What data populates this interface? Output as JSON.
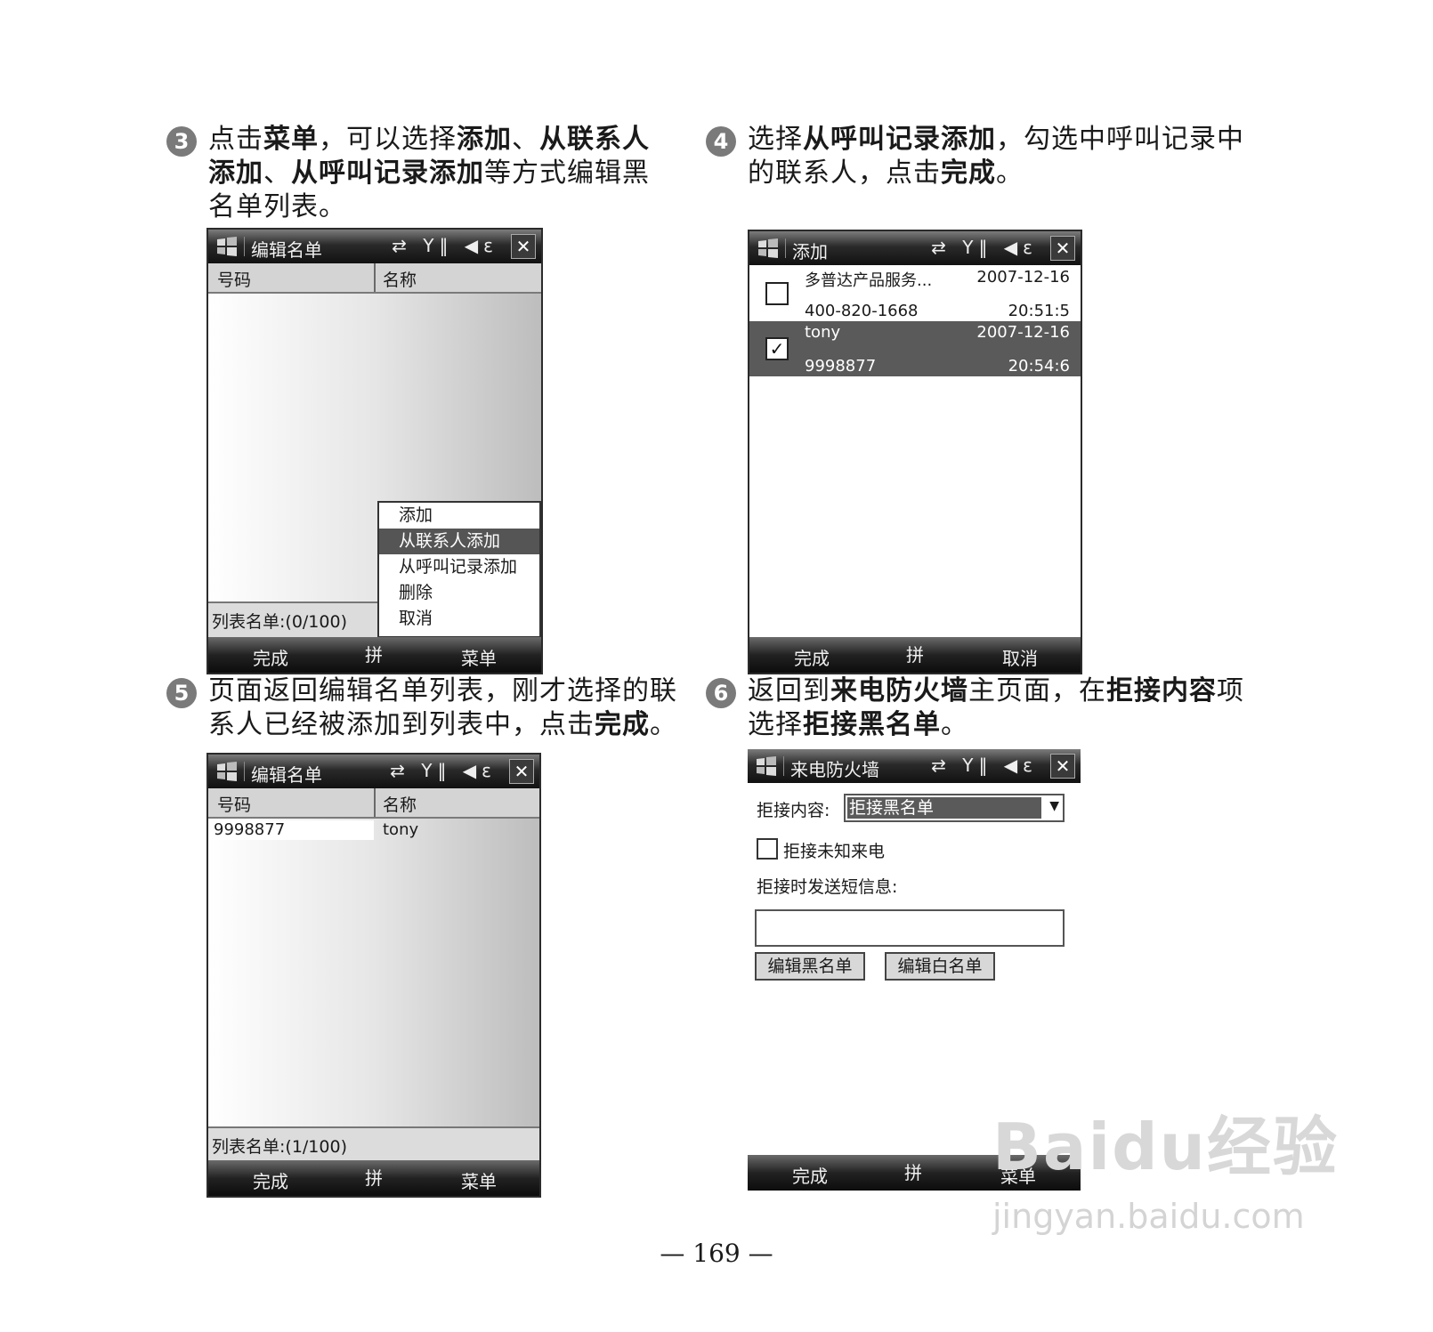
{
  "steps": [
    {
      "num": "3",
      "parts": [
        "点击",
        "菜单",
        "，可以选择",
        "添加",
        "、",
        "从联系人添加",
        "、",
        "从呼叫记录添加",
        "等方式编辑黑名单列表。"
      ]
    },
    {
      "num": "4",
      "parts": [
        "选择",
        "从呼叫记录添加",
        "，勾选中呼叫记录中的联系人，点击",
        "完成",
        "。"
      ]
    },
    {
      "num": "5",
      "parts": [
        "页面返回编辑名单列表，刚才选择的联系人已经被添加到列表中，点击",
        "完成",
        "。"
      ]
    },
    {
      "num": "6",
      "parts": [
        "返回到",
        "来电防火墙",
        "主页面，在",
        "拒接内容",
        "项选择",
        "拒接黑名单",
        "。"
      ]
    }
  ],
  "status_icons": "⇄ Y‖ ◀ε",
  "close_glyph": "✕",
  "screen1": {
    "title": "编辑名单",
    "col1": "号码",
    "col2": "名称",
    "status": "列表名单:(0/100)",
    "menu": [
      "添加",
      "从联系人添加",
      "从呼叫记录添加",
      "删除",
      "取消"
    ],
    "menu_selected": 1,
    "soft_left": "完成",
    "soft_mid": "拼",
    "soft_right": "菜单"
  },
  "screen2": {
    "title": "添加",
    "rows": [
      {
        "name": "多普达产品服务...",
        "date": "2007-12-16",
        "number": "400-820-1668",
        "time": "20:51:5",
        "checked": false
      },
      {
        "name": "tony",
        "date": "2007-12-16",
        "number": "9998877",
        "time": "20:54:6",
        "checked": true
      }
    ],
    "soft_left": "完成",
    "soft_mid": "拼",
    "soft_right": "取消"
  },
  "screen3": {
    "title": "编辑名单",
    "col1": "号码",
    "col2": "名称",
    "row_number": "9998877",
    "row_name": "tony",
    "status": "列表名单:(1/100)",
    "soft_left": "完成",
    "soft_mid": "拼",
    "soft_right": "菜单"
  },
  "screen4": {
    "title": "来电防火墙",
    "reject_label": "拒接内容:",
    "reject_value": "拒接黑名单",
    "unknown_label": "拒接未知来电",
    "sms_label": "拒接时发送短信息:",
    "btn_black": "编辑黑名单",
    "btn_white": "编辑白名单",
    "soft_left": "完成",
    "soft_mid": "拼",
    "soft_right": "菜单"
  },
  "page_number": "— 169 —",
  "watermark_brand": "Baidu经验",
  "watermark_url": "jingyan.baidu.com"
}
